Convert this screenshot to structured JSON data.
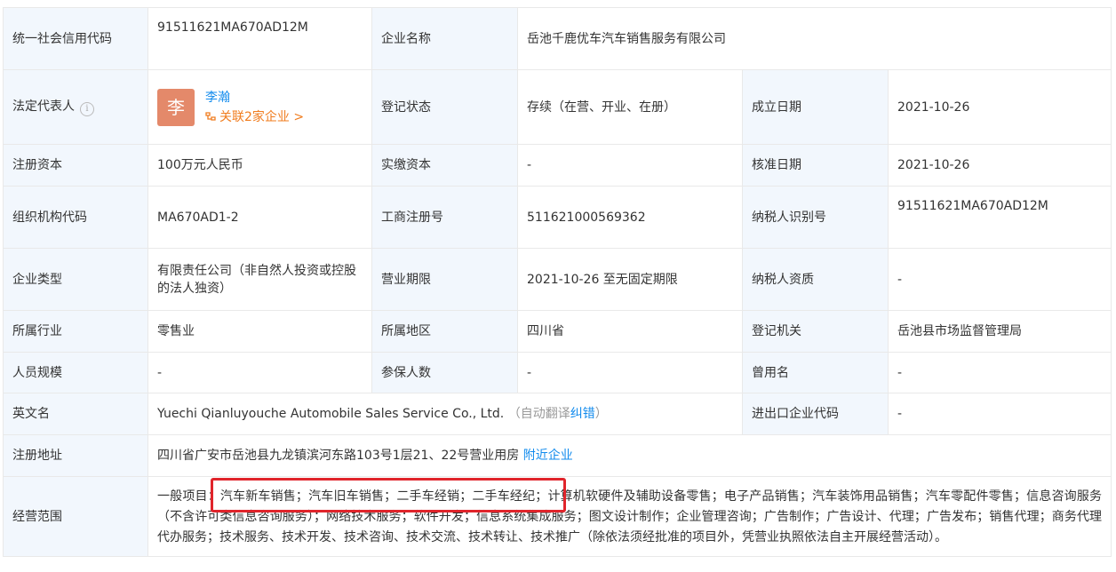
{
  "rows": {
    "credit_code": {
      "label": "统一社会信用代码",
      "value": "91511621MA670AD12M"
    },
    "company_name": {
      "label": "企业名称",
      "value": "岳池千鹿优车汽车销售服务有限公司"
    },
    "legal_rep": {
      "label": "法定代表人",
      "info_icon": "i",
      "avatar_char": "李",
      "name": "李瀚",
      "related": "关联2家企业 >"
    },
    "reg_status": {
      "label": "登记状态",
      "value": "存续（在营、开业、在册）"
    },
    "found_date": {
      "label": "成立日期",
      "value": "2021-10-26"
    },
    "reg_capital": {
      "label": "注册资本",
      "value": "100万元人民币"
    },
    "paid_capital": {
      "label": "实缴资本",
      "value": "-"
    },
    "approve_date": {
      "label": "核准日期",
      "value": "2021-10-26"
    },
    "org_code": {
      "label": "组织机构代码",
      "value": "MA670AD1-2"
    },
    "biz_reg_no": {
      "label": "工商注册号",
      "value": "511621000569362"
    },
    "taxpayer_id": {
      "label": "纳税人识别号",
      "value": "91511621MA670AD12M"
    },
    "company_type": {
      "label": "企业类型",
      "value": "有限责任公司（非自然人投资或控股的法人独资）"
    },
    "biz_term": {
      "label": "营业期限",
      "value": "2021-10-26 至无固定期限"
    },
    "taxpayer_qual": {
      "label": "纳税人资质",
      "value": "-"
    },
    "industry": {
      "label": "所属行业",
      "value": "零售业"
    },
    "region": {
      "label": "所属地区",
      "value": "四川省"
    },
    "reg_authority": {
      "label": "登记机关",
      "value": "岳池县市场监督管理局"
    },
    "staff_size": {
      "label": "人员规模",
      "value": "-"
    },
    "insured": {
      "label": "参保人数",
      "value": "-"
    },
    "former_name": {
      "label": "曾用名",
      "value": "-"
    },
    "english_name": {
      "label": "英文名",
      "value": "Yuechi Qianluyouche Automobile Sales Service Co., Ltd.",
      "auto_note": "（自动翻译",
      "correct_link": "纠错",
      "close_paren": "）"
    },
    "ie_code": {
      "label": "进出口企业代码",
      "value": "-"
    },
    "address": {
      "label": "注册地址",
      "value": "四川省广安市岳池县九龙镇滨河东路103号1层21、22号营业用房",
      "nearby_link": "附近企业"
    },
    "scope": {
      "label": "经营范围",
      "value": "一般项目：汽车新车销售；汽车旧车销售；二手车经销；二手车经纪；计算机软硬件及辅助设备零售；电子产品销售；汽车装饰用品销售；汽车零配件零售；信息咨询服务（不含许可类信息咨询服务）；网络技术服务；软件开发；信息系统集成服务；图文设计制作；企业管理咨询；广告制作；广告设计、代理；广告发布；销售代理；商务代理代办服务；技术服务、技术开发、技术咨询、技术交流、技术转让、技术推广（除依法须经批准的项目外，凭营业执照依法自主开展经营活动）。"
    }
  },
  "colors": {
    "label_bg": "#f2f7fd",
    "link": "#128bed",
    "orange": "#f07c1e",
    "avatar": "#e4896a",
    "highlight": "#e0242b"
  }
}
